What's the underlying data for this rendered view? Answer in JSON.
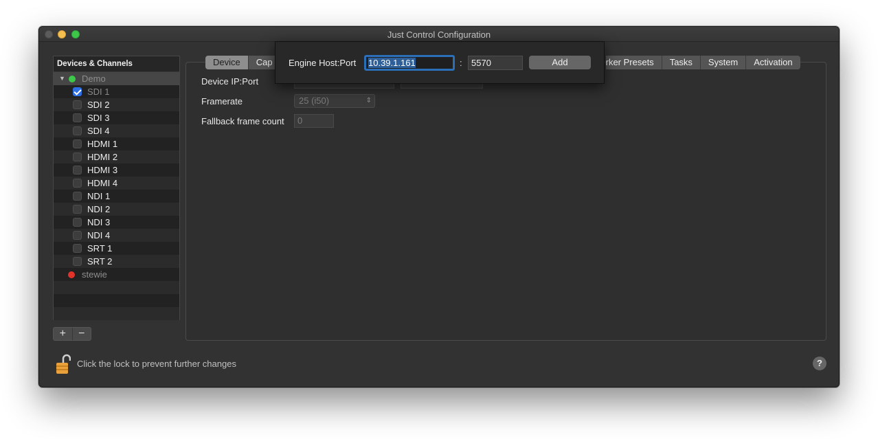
{
  "window": {
    "title": "Just Control Configuration"
  },
  "sidebar": {
    "header": "Devices & Channels",
    "group_demo": "Demo",
    "channels": [
      {
        "label": "SDI 1",
        "checked": true,
        "dim": true
      },
      {
        "label": "SDI 2",
        "checked": false
      },
      {
        "label": "SDI 3",
        "checked": false
      },
      {
        "label": "SDI 4",
        "checked": false
      },
      {
        "label": "HDMI 1",
        "checked": false
      },
      {
        "label": "HDMI 2",
        "checked": false
      },
      {
        "label": "HDMI 3",
        "checked": false
      },
      {
        "label": "HDMI 4",
        "checked": false
      },
      {
        "label": "NDI 1",
        "checked": false
      },
      {
        "label": "NDI 2",
        "checked": false
      },
      {
        "label": "NDI 3",
        "checked": false
      },
      {
        "label": "NDI 4",
        "checked": false
      },
      {
        "label": "SRT 1",
        "checked": false
      },
      {
        "label": "SRT 2",
        "checked": false
      }
    ],
    "group_stewie": "stewie",
    "add_label": "+",
    "remove_label": "−"
  },
  "tabs": {
    "device": "Device",
    "capture": "Cap",
    "marker_presets": "rker Presets",
    "tasks": "Tasks",
    "system": "System",
    "activation": "Activation"
  },
  "form": {
    "ip_label": "Device IP:Port",
    "framerate_label": "Framerate",
    "framerate_value": "25 (i50)",
    "fallback_label": "Fallback frame count",
    "fallback_value": "0"
  },
  "sheet": {
    "label": "Engine Host:Port",
    "host_value": "10.39.1.161",
    "colon": ":",
    "port_value": "5570",
    "add_label": "Add"
  },
  "footer": {
    "lock_text": "Click the lock to prevent further changes",
    "help_label": "?"
  },
  "colors": {
    "accent": "#2f6fe4",
    "status_green": "#3ec84a",
    "status_red": "#e0332a",
    "lock_orange": "#e9a23b"
  }
}
